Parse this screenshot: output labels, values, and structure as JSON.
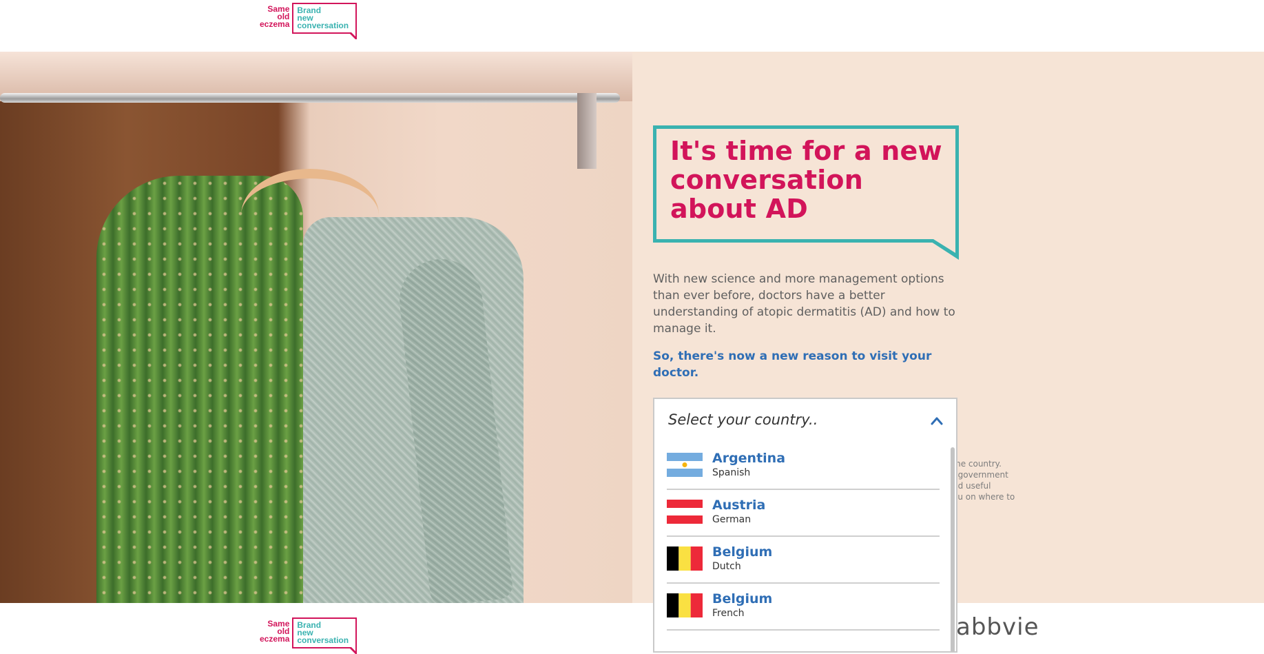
{
  "header": {
    "logo": {
      "left": [
        "Same",
        "old",
        "eczema"
      ],
      "right": [
        "Brand",
        "new",
        "conversation"
      ]
    }
  },
  "hero": {
    "title": "It's time for a new conversation about AD",
    "body": "With new science and more management options than ever before, doctors have a better understanding of atopic dermatitis (AD) and how to manage it.",
    "lead": "So, there's now a new reason to visit your doctor.",
    "side_note_fragments": [
      "me country.",
      ", government",
      "nd useful",
      "ou on where to"
    ]
  },
  "country_select": {
    "placeholder": "Select your country..",
    "expanded": true,
    "options": [
      {
        "country": "Argentina",
        "language": "Spanish",
        "flag_icon": "argentina-flag-icon"
      },
      {
        "country": "Austria",
        "language": "German",
        "flag_icon": "austria-flag-icon"
      },
      {
        "country": "Belgium",
        "language": "Dutch",
        "flag_icon": "belgium-flag-icon"
      },
      {
        "country": "Belgium",
        "language": "French",
        "flag_icon": "belgium-flag-icon"
      }
    ]
  },
  "footer": {
    "logo": {
      "left": [
        "Same",
        "old",
        "eczema"
      ],
      "right": [
        "Brand",
        "new",
        "conversation"
      ]
    },
    "company_logo_text": "abbvie"
  },
  "colors": {
    "accent_pink": "#d2145a",
    "accent_teal": "#3ab2b0",
    "link_blue": "#2f6eb5",
    "hero_bg": "#f6e4d6"
  }
}
